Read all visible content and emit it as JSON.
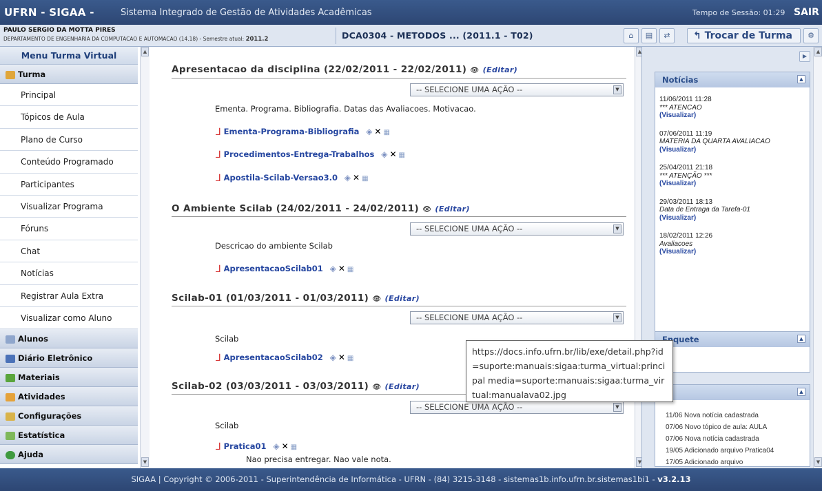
{
  "header": {
    "brand": "UFRN - SIGAA -",
    "system_name": "Sistema Integrado de Gestão de Atividades Acadêmicas",
    "session": "Tempo de Sessão: 01:29",
    "logout": "SAIR"
  },
  "info": {
    "user_name": "PAULO SERGIO DA MOTTA PIRES",
    "department": "DEPARTAMENTO DE ENGENHARIA DA COMPUTACAO E AUTOMACAO (14.18) - Semestre atual:",
    "semester": "2011.2",
    "course": "DCA0304 - METODOS ... (2011.1 - T02)",
    "switch_class": "Trocar de Turma"
  },
  "menu": {
    "title": "Menu Turma Virtual",
    "section_turma": "Turma",
    "items": [
      "Principal",
      "Tópicos de Aula",
      "Plano de Curso",
      "Conteúdo Programado",
      "Participantes",
      "Visualizar Programa",
      "Fóruns",
      "Chat",
      "Notícias",
      "Registrar Aula Extra",
      "Visualizar como Aluno"
    ],
    "sections": [
      "Alunos",
      "Diário Eletrônico",
      "Materiais",
      "Atividades",
      "Configurações",
      "Estatística",
      "Ajuda"
    ]
  },
  "main": {
    "select_placeholder": "-- SELECIONE UMA AÇÃO --",
    "edit_label": "(Editar)",
    "topics": [
      {
        "title": "Apresentacao da disciplina (22/02/2011 - 22/02/2011)",
        "description": "Ementa. Programa. Bibliografia. Datas das Avaliacoes. Motivacao.",
        "files": [
          "Ementa-Programa-Bibliografia",
          "Procedimentos-Entrega-Trabalhos",
          "Apostila-Scilab-Versao3.0"
        ]
      },
      {
        "title": "O Ambiente Scilab (24/02/2011 - 24/02/2011)",
        "description": "Descricao do ambiente Scilab",
        "files": [
          "ApresentacaoScilab01"
        ]
      },
      {
        "title": "Scilab-01 (01/03/2011 - 01/03/2011)",
        "description": "Scilab",
        "files": [
          "ApresentacaoScilab02"
        ]
      },
      {
        "title": "Scilab-02 (03/03/2011 - 03/03/2011)",
        "description": "Scilab",
        "files": [
          "Pratica01"
        ],
        "note": "Nao precisa entregar. Nao vale nota."
      }
    ]
  },
  "right": {
    "news_title": "Notícias",
    "view_label": "(Visualizar)",
    "news": [
      {
        "date": "11/06/2011 11:28",
        "text": "*** ATENCAO"
      },
      {
        "date": "07/06/2011 11:19",
        "text": "MATERIA DA QUARTA AVALIACAO"
      },
      {
        "date": "25/04/2011 21:18",
        "text": "*** ATENÇÃO ***"
      },
      {
        "date": "29/03/2011 18:13",
        "text": "Data de Entraga da Tarefa-01"
      },
      {
        "date": "18/02/2011 12:26",
        "text": "Avaliacoes"
      }
    ],
    "poll_title": "Enquete",
    "activities": [
      "11/06 Nova notícia cadastrada",
      "07/06 Novo tópico de aula: AULA",
      "07/06 Nova notícia cadastrada",
      "19/05 Adicionado arquivo Pratica04",
      "17/05 Adicionado arquivo"
    ]
  },
  "tooltip": "https://docs.info.ufrn.br/lib/exe/detail.php?id=suporte:manuais:sigaa:turma_virtual:principal media=suporte:manuais:sigaa:turma_virtual:manualava02.jpg",
  "footer": {
    "text": "SIGAA | Copyright © 2006-2011 - Superintendência de Informática - UFRN - (84) 3215-3148 - sistemas1b.info.ufrn.br.sistemas1bi1 -",
    "version": "v3.2.13"
  },
  "colors": {
    "header_bg": "#2d4673",
    "link": "#2546a0",
    "panel_bg": "#dfe6f1"
  }
}
